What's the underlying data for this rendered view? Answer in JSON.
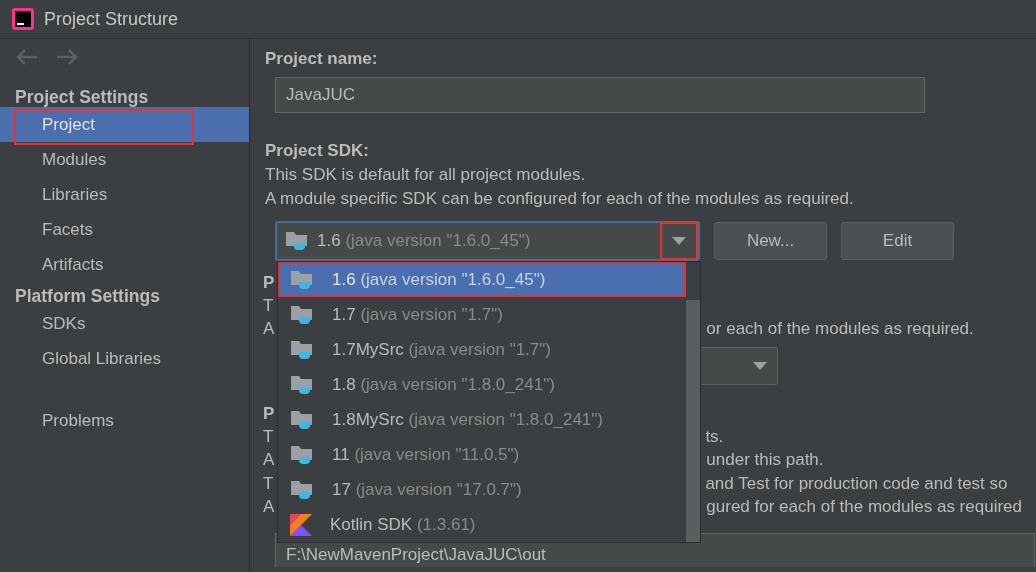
{
  "window": {
    "title": "Project Structure"
  },
  "sidebar": {
    "groups": [
      {
        "heading": "Project Settings",
        "items": [
          {
            "label": "Project",
            "selected": true,
            "annotated": true
          },
          {
            "label": "Modules",
            "selected": false,
            "annotated": false
          },
          {
            "label": "Libraries",
            "selected": false,
            "annotated": false
          },
          {
            "label": "Facets",
            "selected": false,
            "annotated": false
          },
          {
            "label": "Artifacts",
            "selected": false,
            "annotated": false
          }
        ]
      },
      {
        "heading": "Platform Settings",
        "items": [
          {
            "label": "SDKs",
            "selected": false,
            "annotated": false
          },
          {
            "label": "Global Libraries",
            "selected": false,
            "annotated": false
          }
        ]
      },
      {
        "items": [
          {
            "label": "Problems",
            "selected": false,
            "annotated": false
          }
        ]
      }
    ]
  },
  "project_name": {
    "label": "Project name:",
    "value": "JavaJUC"
  },
  "project_sdk": {
    "label": "Project SDK:",
    "description": [
      "This SDK is default for all project modules.",
      "A module specific SDK can be configured for each of the modules as required."
    ],
    "combo": {
      "name": "1.6",
      "detail": "(java version \"1.6.0_45\")",
      "arrow_annotated": true
    },
    "buttons": [
      "New...",
      "Edit"
    ]
  },
  "covered_rows": [
    {
      "kind": "heading",
      "head": "P"
    },
    {
      "kind": "text",
      "head": "T"
    },
    {
      "kind": "text",
      "head": "A",
      "tail": "or each of the modules as required."
    },
    {
      "kind": "combo"
    },
    {
      "kind": "heading",
      "head": "P"
    },
    {
      "kind": "text",
      "head": "T",
      "tail": "ts."
    },
    {
      "kind": "text",
      "head": "A",
      "tail": "under this path."
    },
    {
      "kind": "text",
      "head": "T",
      "tail": "and Test for production code and test so"
    },
    {
      "kind": "text",
      "head": "A",
      "tail": "gured for each of the modules as required"
    },
    {
      "kind": "field",
      "value": "F:\\NewMavenProject\\JavaJUC\\out"
    }
  ],
  "sdk_popup": {
    "items": [
      {
        "kind": "jdk",
        "name": "1.6",
        "detail": "(java version \"1.6.0_45\")",
        "selected": true,
        "annotated": true
      },
      {
        "kind": "jdk",
        "name": "1.7",
        "detail": "(java version \"1.7\")",
        "selected": false,
        "annotated": false
      },
      {
        "kind": "jdk",
        "name": "1.7MySrc",
        "detail": "(java version \"1.7\")",
        "selected": false,
        "annotated": false
      },
      {
        "kind": "jdk",
        "name": "1.8",
        "detail": "(java version \"1.8.0_241\")",
        "selected": false,
        "annotated": false
      },
      {
        "kind": "jdk",
        "name": "1.8MySrc",
        "detail": "(java version \"1.8.0_241\")",
        "selected": false,
        "annotated": false
      },
      {
        "kind": "jdk",
        "name": "11",
        "detail": "(java version \"11.0.5\")",
        "selected": false,
        "annotated": false
      },
      {
        "kind": "jdk",
        "name": "17",
        "detail": "(java version \"17.0.7\")",
        "selected": false,
        "annotated": false
      },
      {
        "kind": "kotlin",
        "name": "Kotlin SDK",
        "detail": "(1.3.61)",
        "selected": false,
        "annotated": false
      }
    ]
  }
}
